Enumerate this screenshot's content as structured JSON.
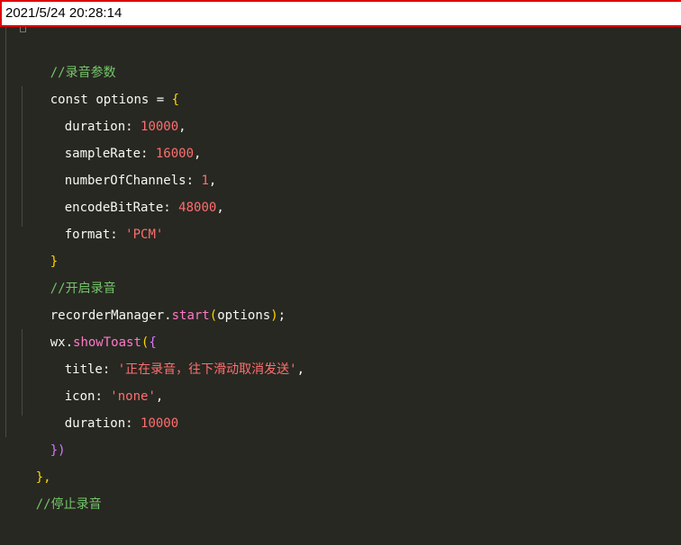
{
  "timestamp": "2021/5/24 20:28:14",
  "code": {
    "comment_params": "//录音参数",
    "const_kw": "const",
    "options_var": "options",
    "eq": " = ",
    "open_brace": "{",
    "duration_key": "duration",
    "duration_val": "10000",
    "sampleRate_key": "sampleRate",
    "sampleRate_val": "16000",
    "channels_key": "numberOfChannels",
    "channels_val": "1",
    "bitrate_key": "encodeBitRate",
    "bitrate_val": "48000",
    "format_key": "format",
    "format_val": "'PCM'",
    "close_brace": "}",
    "comment_start": "//开启录音",
    "recorder_obj": "recorderManager",
    "start_fn": "start",
    "start_arg": "options",
    "wx_obj": "wx",
    "toast_fn": "showToast",
    "title_key": "title",
    "title_val": "'正在录音，往下滑动取消发送'",
    "icon_key": "icon",
    "icon_val": "'none'",
    "toast_duration_key": "duration",
    "toast_duration_val": "10000",
    "close_call": "})",
    "close_outer": "},",
    "comment_stop": "//停止录音"
  },
  "colors": {
    "background": "#272822",
    "comment": "#75c56a",
    "number": "#ff6e6e",
    "string": "#ff6e6e",
    "function": "#ff79c6",
    "brace": "#ffd700",
    "paren": "#d777ff"
  }
}
